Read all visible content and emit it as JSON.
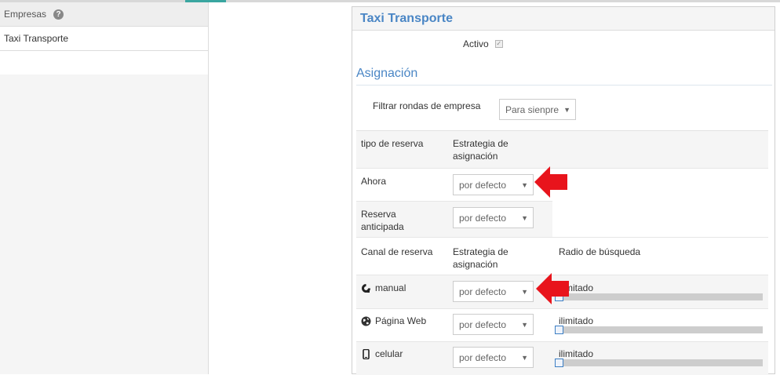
{
  "sidebar": {
    "header": "Empresas",
    "help_icon": "help-icon",
    "items": [
      {
        "label": "Taxi Transporte"
      }
    ]
  },
  "panel": {
    "title": "Taxi Transporte",
    "active": {
      "label": "Activo",
      "checked": true
    },
    "section_title": "Asignación",
    "filter": {
      "label": "Filtrar rondas de empresa",
      "value": "Para sienpre"
    },
    "booking_table": {
      "headers": [
        "tipo de reserva",
        "Estrategia de asignación"
      ],
      "rows": [
        {
          "type": "Ahora",
          "strategy": "por defecto"
        },
        {
          "type": "Reserva anticipada",
          "strategy": "por defecto"
        }
      ]
    },
    "channel_table": {
      "headers": [
        "Canal de reserva",
        "Estrategia de asignación",
        "Radio de búsqueda"
      ],
      "rows": [
        {
          "icon": "headset-icon",
          "channel": "manual",
          "strategy": "por defecto",
          "radius_label": "ilimitado",
          "radius_level": 0
        },
        {
          "icon": "globe-icon",
          "channel": "Página Web",
          "strategy": "por defecto",
          "radius_label": "ilimitado",
          "radius_level": 0
        },
        {
          "icon": "mobile-phone-icon",
          "channel": "celular",
          "strategy": "por defecto",
          "radius_label": "ilimitado",
          "radius_level": 0
        }
      ]
    }
  },
  "annotations": {
    "arrow_color": "#e8141c"
  }
}
